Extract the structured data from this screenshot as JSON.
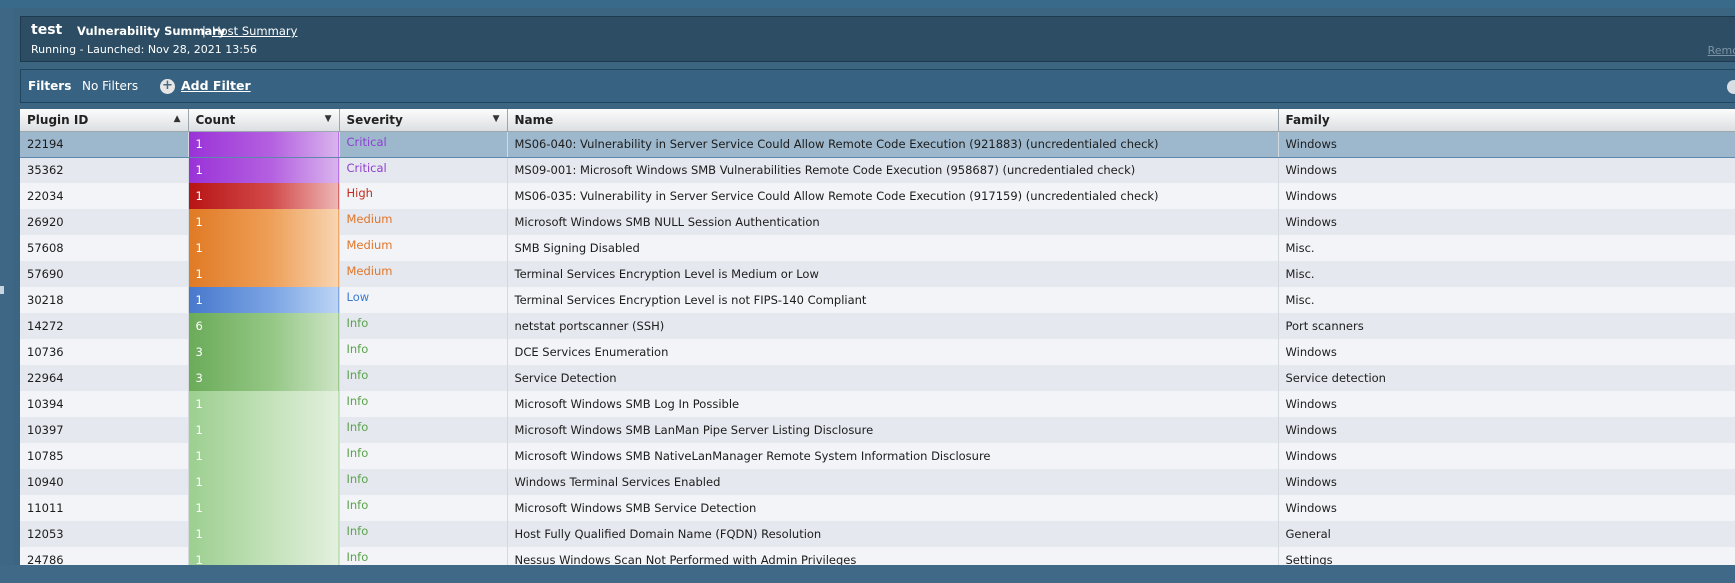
{
  "header": {
    "scan_name": "test",
    "tab_vulnerability_summary": "Vulnerability Summary",
    "tab_separator": "|",
    "tab_host_summary": "Host Summary",
    "status": "Running - Launched: Nov 28, 2021 13:56",
    "remove_link": "Remo"
  },
  "filters": {
    "label": "Filters",
    "value": "No Filters",
    "add_filter": "Add Filter"
  },
  "columns": {
    "plugin_id": "Plugin ID",
    "count": "Count",
    "severity": "Severity",
    "name": "Name",
    "family": "Family"
  },
  "severity_colors": {
    "Critical": "#8e3fd0",
    "High": "#c42b1c",
    "Medium": "#e07528",
    "Low": "#3d7bd0",
    "Info": "#5aa24a"
  },
  "rows": [
    {
      "plugin_id": "22194",
      "count": "1",
      "severity": "Critical",
      "name": "MS06-040: Vulnerability in Server Service Could Allow Remote Code Execution (921883) (uncredentialed check)",
      "family": "Windows"
    },
    {
      "plugin_id": "35362",
      "count": "1",
      "severity": "Critical",
      "name": "MS09-001: Microsoft Windows SMB Vulnerabilities Remote Code Execution (958687) (uncredentialed check)",
      "family": "Windows"
    },
    {
      "plugin_id": "22034",
      "count": "1",
      "severity": "High",
      "name": "MS06-035: Vulnerability in Server Service Could Allow Remote Code Execution (917159) (uncredentialed check)",
      "family": "Windows"
    },
    {
      "plugin_id": "26920",
      "count": "1",
      "severity": "Medium",
      "name": "Microsoft Windows SMB NULL Session Authentication",
      "family": "Windows"
    },
    {
      "plugin_id": "57608",
      "count": "1",
      "severity": "Medium",
      "name": "SMB Signing Disabled",
      "family": "Misc."
    },
    {
      "plugin_id": "57690",
      "count": "1",
      "severity": "Medium",
      "name": "Terminal Services Encryption Level is Medium or Low",
      "family": "Misc."
    },
    {
      "plugin_id": "30218",
      "count": "1",
      "severity": "Low",
      "name": "Terminal Services Encryption Level is not FIPS-140 Compliant",
      "family": "Misc."
    },
    {
      "plugin_id": "14272",
      "count": "6",
      "severity": "Info",
      "name": "netstat portscanner (SSH)",
      "family": "Port scanners"
    },
    {
      "plugin_id": "10736",
      "count": "3",
      "severity": "Info",
      "name": "DCE Services Enumeration",
      "family": "Windows"
    },
    {
      "plugin_id": "22964",
      "count": "3",
      "severity": "Info",
      "name": "Service Detection",
      "family": "Service detection"
    },
    {
      "plugin_id": "10394",
      "count": "1",
      "severity": "Info",
      "name": "Microsoft Windows SMB Log In Possible",
      "family": "Windows"
    },
    {
      "plugin_id": "10397",
      "count": "1",
      "severity": "Info",
      "name": "Microsoft Windows SMB LanMan Pipe Server Listing Disclosure",
      "family": "Windows"
    },
    {
      "plugin_id": "10785",
      "count": "1",
      "severity": "Info",
      "name": "Microsoft Windows SMB NativeLanManager Remote System Information Disclosure",
      "family": "Windows"
    },
    {
      "plugin_id": "10940",
      "count": "1",
      "severity": "Info",
      "name": "Windows Terminal Services Enabled",
      "family": "Windows"
    },
    {
      "plugin_id": "11011",
      "count": "1",
      "severity": "Info",
      "name": "Microsoft Windows SMB Service Detection",
      "family": "Windows"
    },
    {
      "plugin_id": "12053",
      "count": "1",
      "severity": "Info",
      "name": "Host Fully Qualified Domain Name (FQDN) Resolution",
      "family": "General"
    },
    {
      "plugin_id": "24786",
      "count": "1",
      "severity": "Info",
      "name": "Nessus Windows Scan Not Performed with Admin Privileges",
      "family": "Settings"
    }
  ]
}
